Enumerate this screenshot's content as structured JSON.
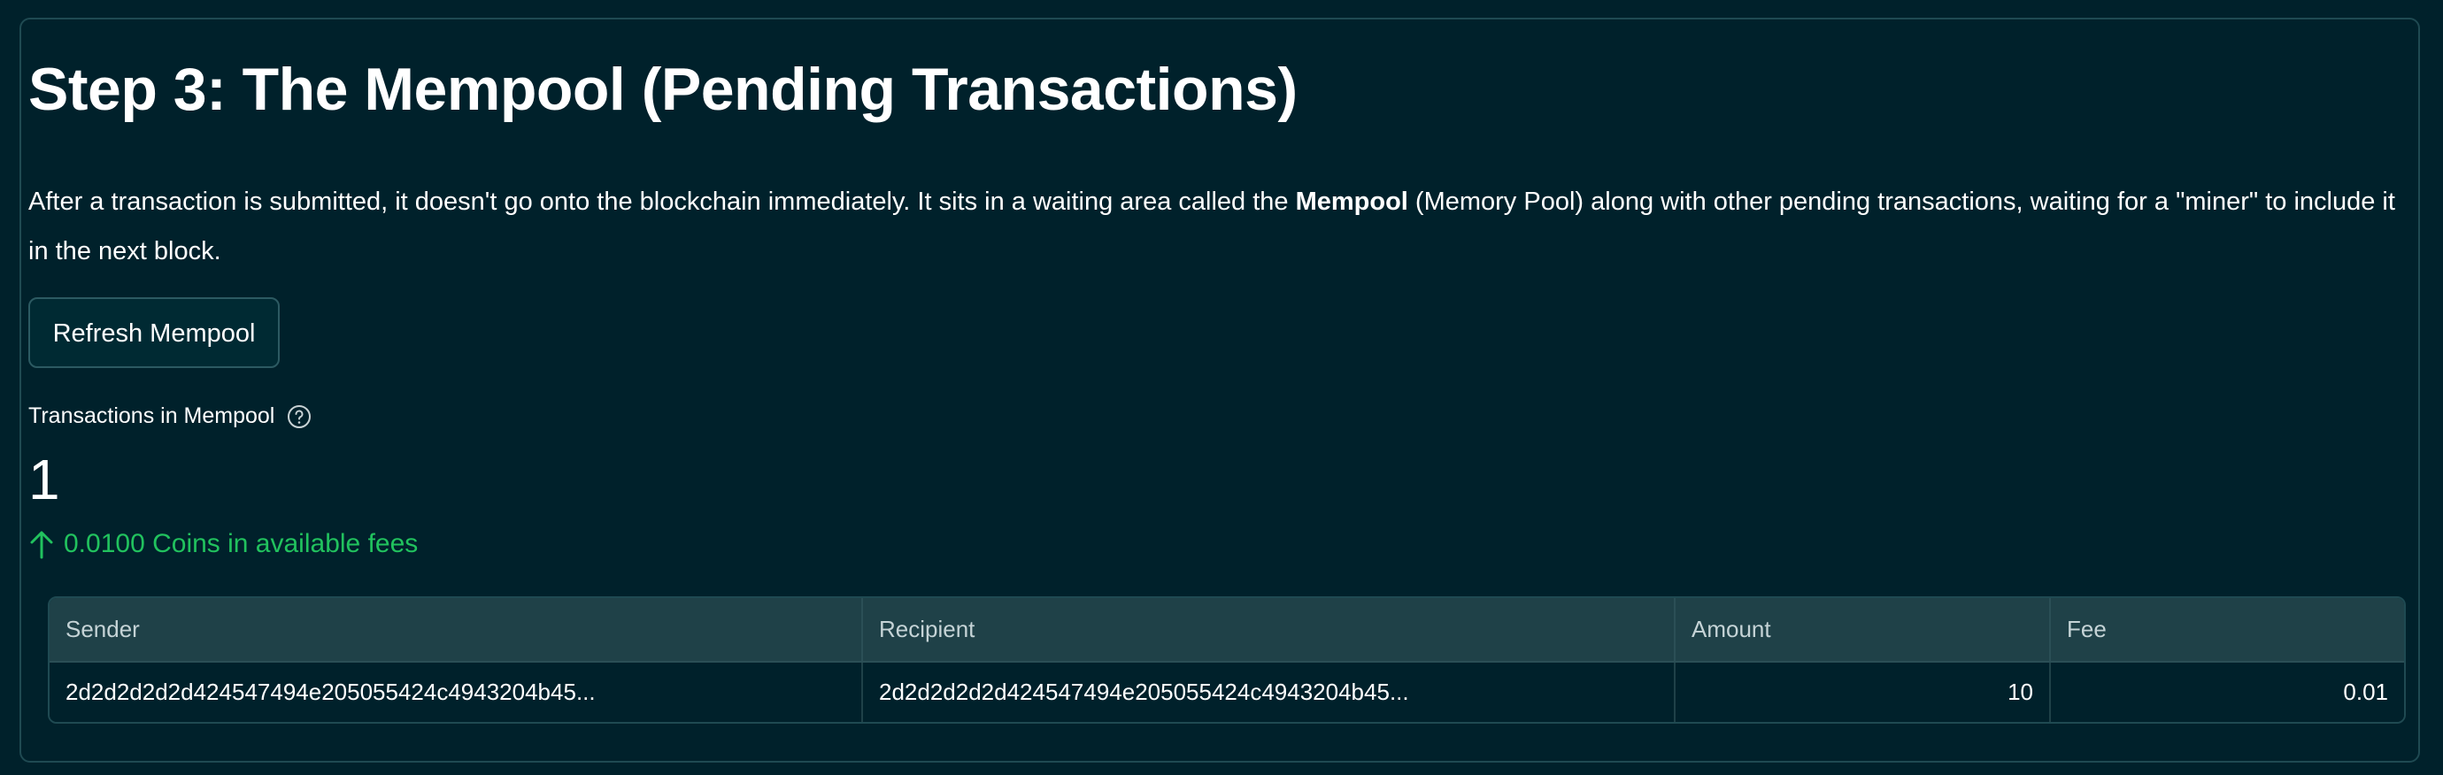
{
  "section": {
    "title": "Step 3: The Mempool (Pending Transactions)",
    "description_before": "After a transaction is submitted, it doesn't go onto the blockchain immediately. It sits in a waiting area called the ",
    "description_bold": "Mempool",
    "description_after": " (Memory Pool) along with other pending transactions, waiting for a \"miner\" to include it in the next block."
  },
  "refresh_button": {
    "label": "Refresh Mempool"
  },
  "metric": {
    "label": "Transactions in Mempool",
    "help_icon": "question-circle-icon",
    "value": "1",
    "delta_icon": "arrow-up-icon",
    "delta": "0.0100 Coins in available fees",
    "delta_color": "#21c25e"
  },
  "table": {
    "columns": [
      "Sender",
      "Recipient",
      "Amount",
      "Fee"
    ],
    "rows": [
      {
        "sender": "2d2d2d2d2d424547494e205055424c4943204b45...",
        "recipient": "2d2d2d2d2d424547494e205055424c4943204b45...",
        "amount": "10",
        "fee": "0.01"
      }
    ]
  },
  "colors": {
    "background": "#00212b",
    "header_bg": "#1f4148",
    "border": "#1f4a52",
    "accent_green": "#21c25e"
  }
}
